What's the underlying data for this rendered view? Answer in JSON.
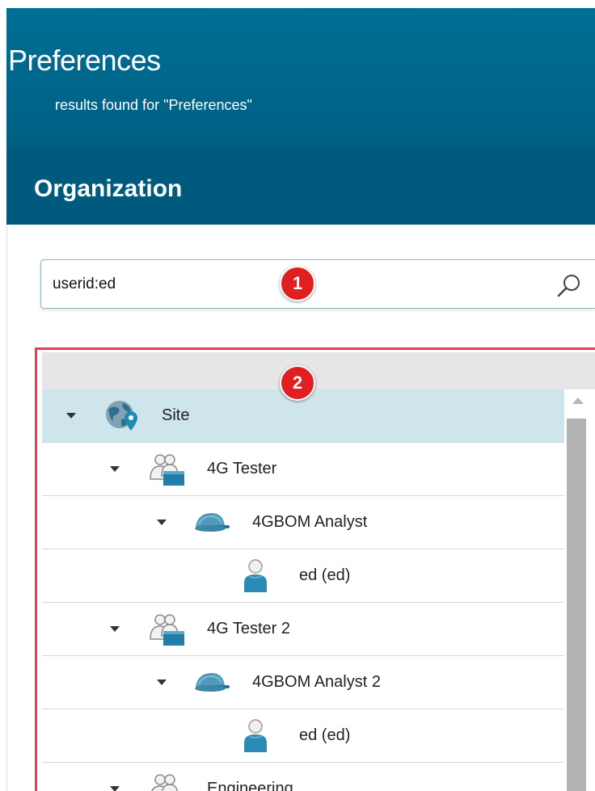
{
  "header": {
    "title": "Preferences",
    "subtitle": "results found for \"Preferences\""
  },
  "organization": {
    "title": "Organization"
  },
  "search": {
    "value": "userid:ed",
    "icon": "search-icon"
  },
  "annotations": [
    {
      "label": "1",
      "color": "#e02020"
    },
    {
      "label": "2",
      "color": "#e02020"
    }
  ],
  "tree": {
    "nodes": [
      {
        "label": "Site",
        "type": "site",
        "level": 0,
        "expanded": true,
        "selected": true,
        "icon": "globe-pin-icon"
      },
      {
        "label": "4G Tester",
        "type": "group",
        "level": 1,
        "expanded": true,
        "selected": false,
        "icon": "group-icon"
      },
      {
        "label": "4GBOM Analyst",
        "type": "role",
        "level": 2,
        "expanded": true,
        "selected": false,
        "icon": "cap-icon"
      },
      {
        "label": "ed (ed)",
        "type": "user",
        "level": 3,
        "expanded": null,
        "selected": false,
        "icon": "user-icon"
      },
      {
        "label": "4G Tester 2",
        "type": "group",
        "level": 1,
        "expanded": true,
        "selected": false,
        "icon": "group-icon"
      },
      {
        "label": "4GBOM Analyst 2",
        "type": "role",
        "level": 2,
        "expanded": true,
        "selected": false,
        "icon": "cap-icon"
      },
      {
        "label": "ed (ed)",
        "type": "user",
        "level": 3,
        "expanded": null,
        "selected": false,
        "icon": "user-icon"
      },
      {
        "label": "Engineering",
        "type": "group",
        "level": 1,
        "expanded": true,
        "selected": false,
        "icon": "group-icon"
      }
    ]
  },
  "colors": {
    "header_bg": "#006f96",
    "org_bg": "#005a7d",
    "selection_bg": "#cfe5ec",
    "highlight_border": "#e8404a",
    "icon_blue": "#1f8ab3"
  }
}
